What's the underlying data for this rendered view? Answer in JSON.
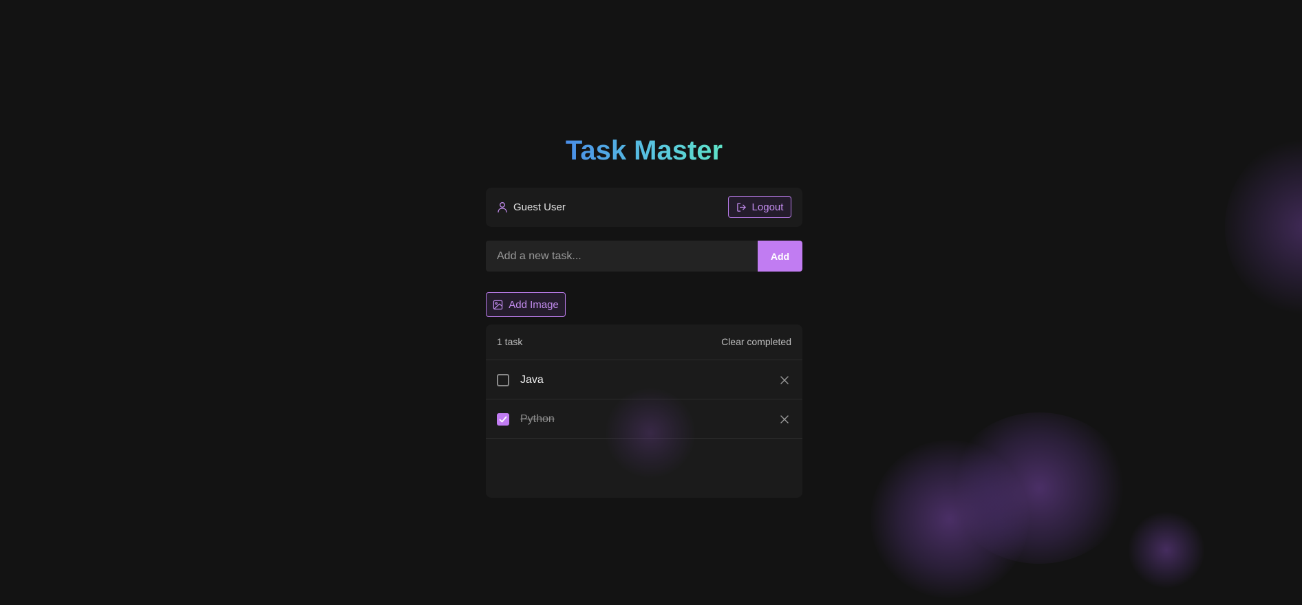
{
  "app": {
    "title": "Task Master"
  },
  "user_bar": {
    "user_icon": "user-icon",
    "user_name": "Guest User",
    "logout_icon": "logout-icon",
    "logout_label": "Logout"
  },
  "new_task": {
    "placeholder": "Add a new task...",
    "value": "",
    "add_label": "Add"
  },
  "add_image": {
    "icon": "image-icon",
    "label": "Add Image"
  },
  "task_list": {
    "count_label": "1 task",
    "clear_label": "Clear completed",
    "items": [
      {
        "text": "Java",
        "completed": false,
        "delete_icon": "close-icon"
      },
      {
        "text": "Python",
        "completed": true,
        "delete_icon": "close-icon"
      }
    ]
  },
  "colors": {
    "background": "#131313",
    "panel": "#1b1b1b",
    "accent": "#c17cf2",
    "title_gradient_start": "#4a8ee8",
    "title_gradient_end": "#5fe3c8"
  }
}
